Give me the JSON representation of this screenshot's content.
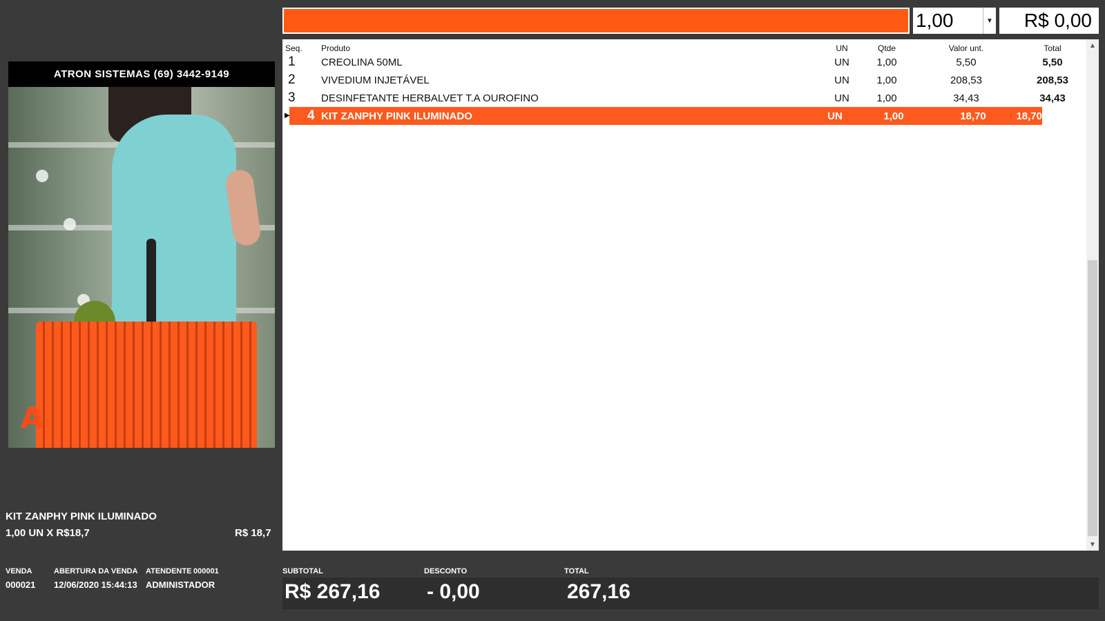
{
  "top_bar": {
    "barcode_value": "",
    "quantity": "1,00",
    "unit_price": "R$ 0,00"
  },
  "grid": {
    "headers": {
      "seq": "Seq.",
      "produto": "Produto",
      "un": "UN",
      "qtde": "Qtde",
      "valor_unit": "Valor unt.",
      "total": "Total"
    },
    "rows": [
      {
        "seq": "1",
        "produto": "CREOLINA 50ML",
        "un": "UN",
        "qtde": "1,00",
        "valor_unit": "5,50",
        "total": "5,50"
      },
      {
        "seq": "2",
        "produto": "VIVEDIUM INJETÁVEL",
        "un": "UN",
        "qtde": "1,00",
        "valor_unit": "208,53",
        "total": "208,53"
      },
      {
        "seq": "3",
        "produto": "DESINFETANTE HERBALVET T.A OUROFINO",
        "un": "UN",
        "qtde": "1,00",
        "valor_unit": "34,43",
        "total": "34,43"
      },
      {
        "seq": "4",
        "produto": "KIT ZANPHY PINK ILUMINADO",
        "un": "UN",
        "qtde": "1,00",
        "valor_unit": "18,70",
        "total": "18,70"
      }
    ],
    "selected_row_index": 3
  },
  "ad": {
    "header": "ATRON SISTEMAS (69) 3442-9149",
    "logo_icon": "atron-logo-icon"
  },
  "current_item": {
    "name": "KIT ZANPHY PINK ILUMINADO",
    "qty_line": "1,00 UN X R$18,7",
    "price": "R$ 18,7"
  },
  "sale_info": {
    "venda_label": "VENDA",
    "venda_value": "000021",
    "abertura_label": "ABERTURA DA VENDA",
    "abertura_value": "12/06/2020 15:44:13",
    "atendente_label": "ATENDENTE",
    "atendente_code": "000001",
    "atendente_name": "ADMINISTADOR"
  },
  "totals": {
    "subtotal_label": "SUBTOTAL",
    "subtotal_value": "R$ 267,16",
    "desconto_label": "DESCONTO",
    "desconto_value": "- 0,00",
    "total_label": "TOTAL",
    "total_value": "267,16"
  },
  "colors": {
    "accent": "#ff5a1e",
    "background": "#3a3a3a"
  }
}
